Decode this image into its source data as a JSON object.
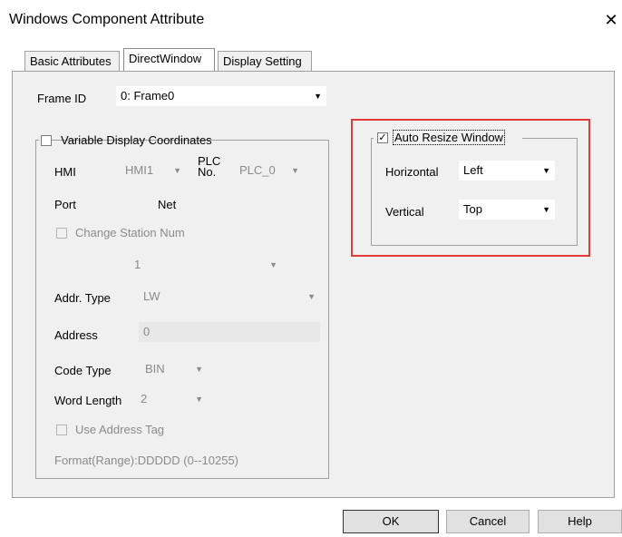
{
  "window": {
    "title": "Windows Component Attribute",
    "close_icon": "✕"
  },
  "tabs": [
    {
      "label": "Basic Attributes"
    },
    {
      "label": "DirectWindow"
    },
    {
      "label": "Display Setting"
    }
  ],
  "frame": {
    "label": "Frame ID",
    "value": "0: Frame0"
  },
  "variable": {
    "checkbox_label": "Variable Display Coordinates",
    "hmi_label": "HMI",
    "hmi_value": "HMI1",
    "plc_label_1": "PLC",
    "plc_label_2": "No.",
    "plc_value": "PLC_0",
    "port_label": "Port",
    "port_value": "Net",
    "change_station_label": "Change Station Num",
    "station_value": "1",
    "addr_type_label": "Addr. Type",
    "addr_type_value": "LW",
    "address_label": "Address",
    "address_value": "0",
    "code_type_label": "Code Type",
    "code_type_value": "BIN",
    "word_length_label": "Word Length",
    "word_length_value": "2",
    "use_tag_label": "Use Address Tag",
    "format_text": "Format(Range):DDDDD (0--10255)"
  },
  "resize": {
    "checkbox_label": "Auto Resize Window",
    "checked": true,
    "horizontal_label": "Horizontal",
    "horizontal_value": "Left",
    "vertical_label": "Vertical",
    "vertical_value": "Top",
    "highlight_color": "#e53935"
  },
  "buttons": {
    "ok": "OK",
    "cancel": "Cancel",
    "help": "Help"
  }
}
